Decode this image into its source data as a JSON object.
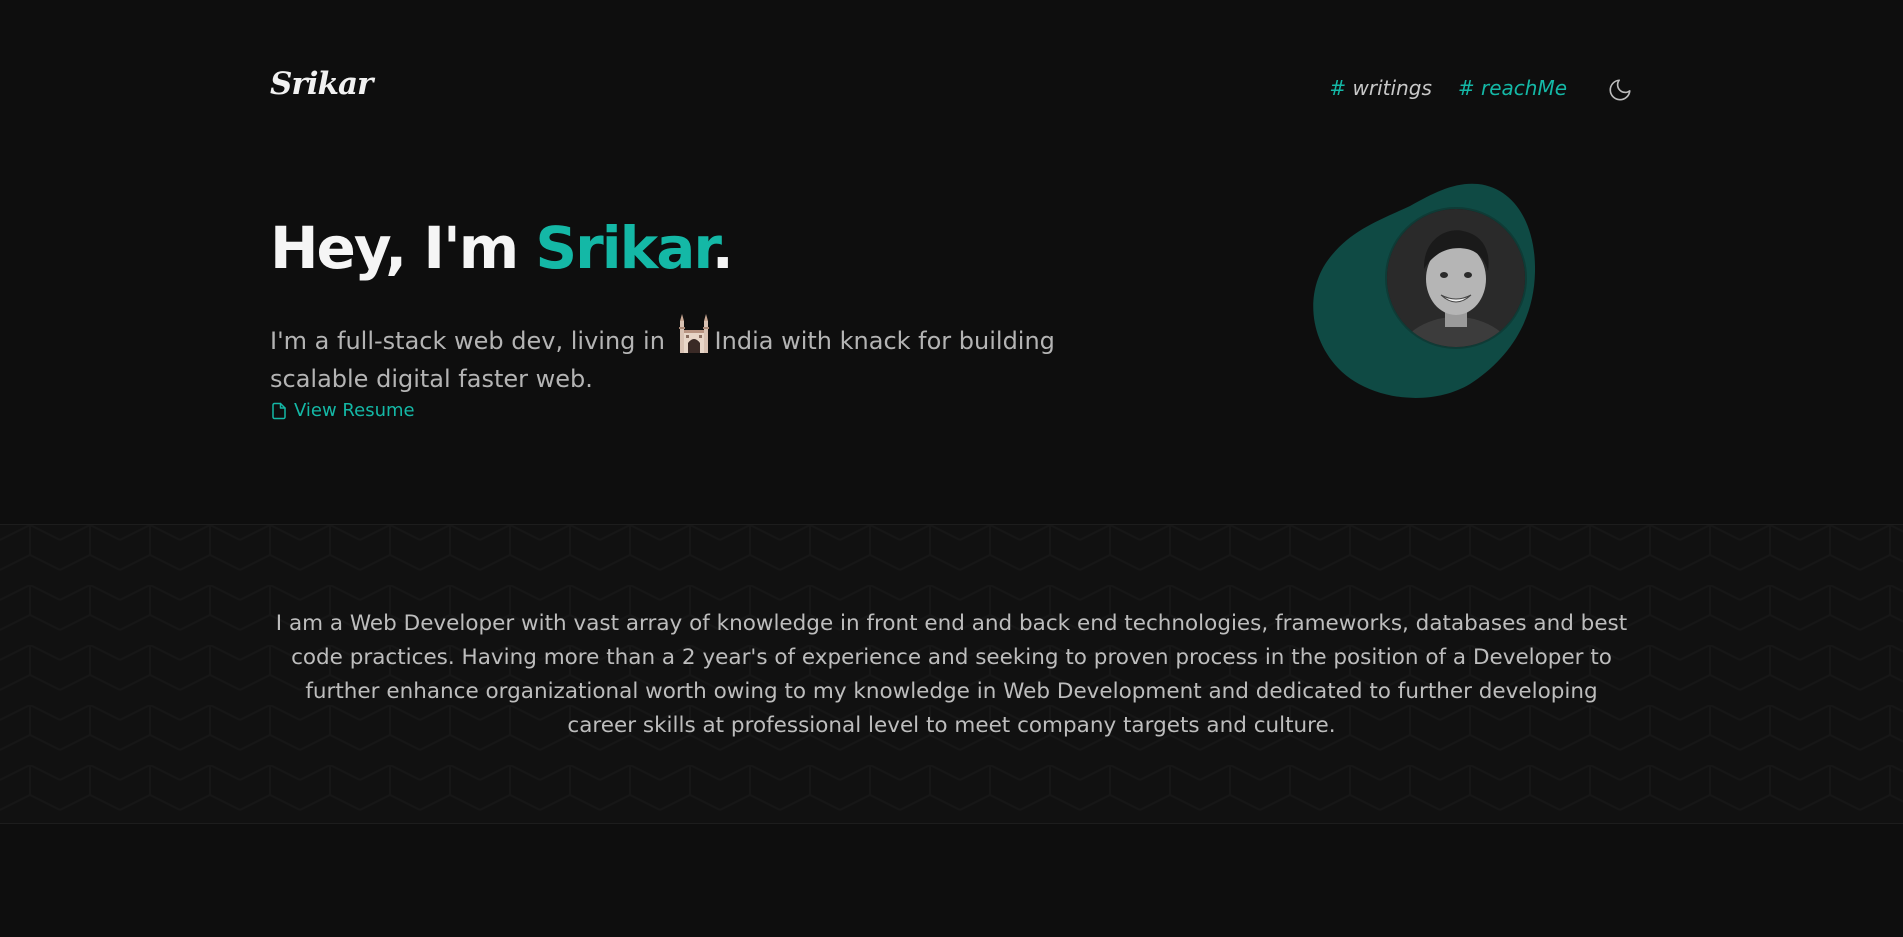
{
  "header": {
    "logo": "Srikar",
    "nav": [
      {
        "hash": "#",
        "label": "writings"
      },
      {
        "hash": "#",
        "label": "reachMe"
      }
    ],
    "theme_icon": "moon-icon"
  },
  "hero": {
    "greeting": "Hey, I'm",
    "name": "Srikar",
    "period": ".",
    "sub_before": "I'm a full-stack web dev, living in",
    "sub_after": "India with knack for building scalable digital faster web.",
    "landmark_icon": "charminar-icon",
    "resume_label": "View Resume"
  },
  "about": {
    "text": "I am a Web Developer with vast array of knowledge in front end and back end technologies, frameworks, databases and best code practices. Having more than a 2 year's of experience and seeking to proven process in the position of a Developer to further enhance organizational worth owing to my knowledge in Web Development and dedicated to further developing career skills at professional level to meet company targets and culture."
  },
  "colors": {
    "background": "#0e0e0e",
    "accent": "#14b8a6",
    "blob": "#0f4a44"
  }
}
